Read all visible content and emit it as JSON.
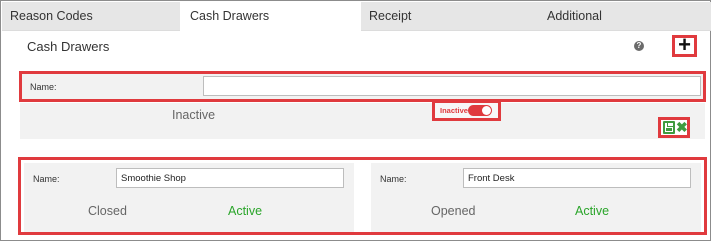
{
  "tabs": [
    {
      "label": "Reason Codes"
    },
    {
      "label": "Cash Drawers"
    },
    {
      "label": "Receipt"
    },
    {
      "label": "Additional"
    }
  ],
  "section": {
    "title": "Cash Drawers",
    "help_glyph": "?",
    "add_glyph": "+"
  },
  "new_drawer": {
    "name_label": "Name:",
    "name_value": "",
    "status_text": "Inactive",
    "toggle_label": "Inactive",
    "toggle_on": false,
    "toggle_color": "#e03a3e"
  },
  "drawers": [
    {
      "name_label": "Name:",
      "name_value": "Smoothie Shop",
      "state": "Closed",
      "status": "Active"
    },
    {
      "name_label": "Name:",
      "name_value": "Front Desk",
      "state": "Opened",
      "status": "Active"
    }
  ],
  "colors": {
    "highlight": "#e03a3e",
    "active_green": "#2aa52a",
    "icon_green": "#3f9b3f"
  },
  "icons": {
    "help": "help-icon",
    "add": "plus-icon",
    "save": "save-icon",
    "cancel": "close-icon"
  }
}
